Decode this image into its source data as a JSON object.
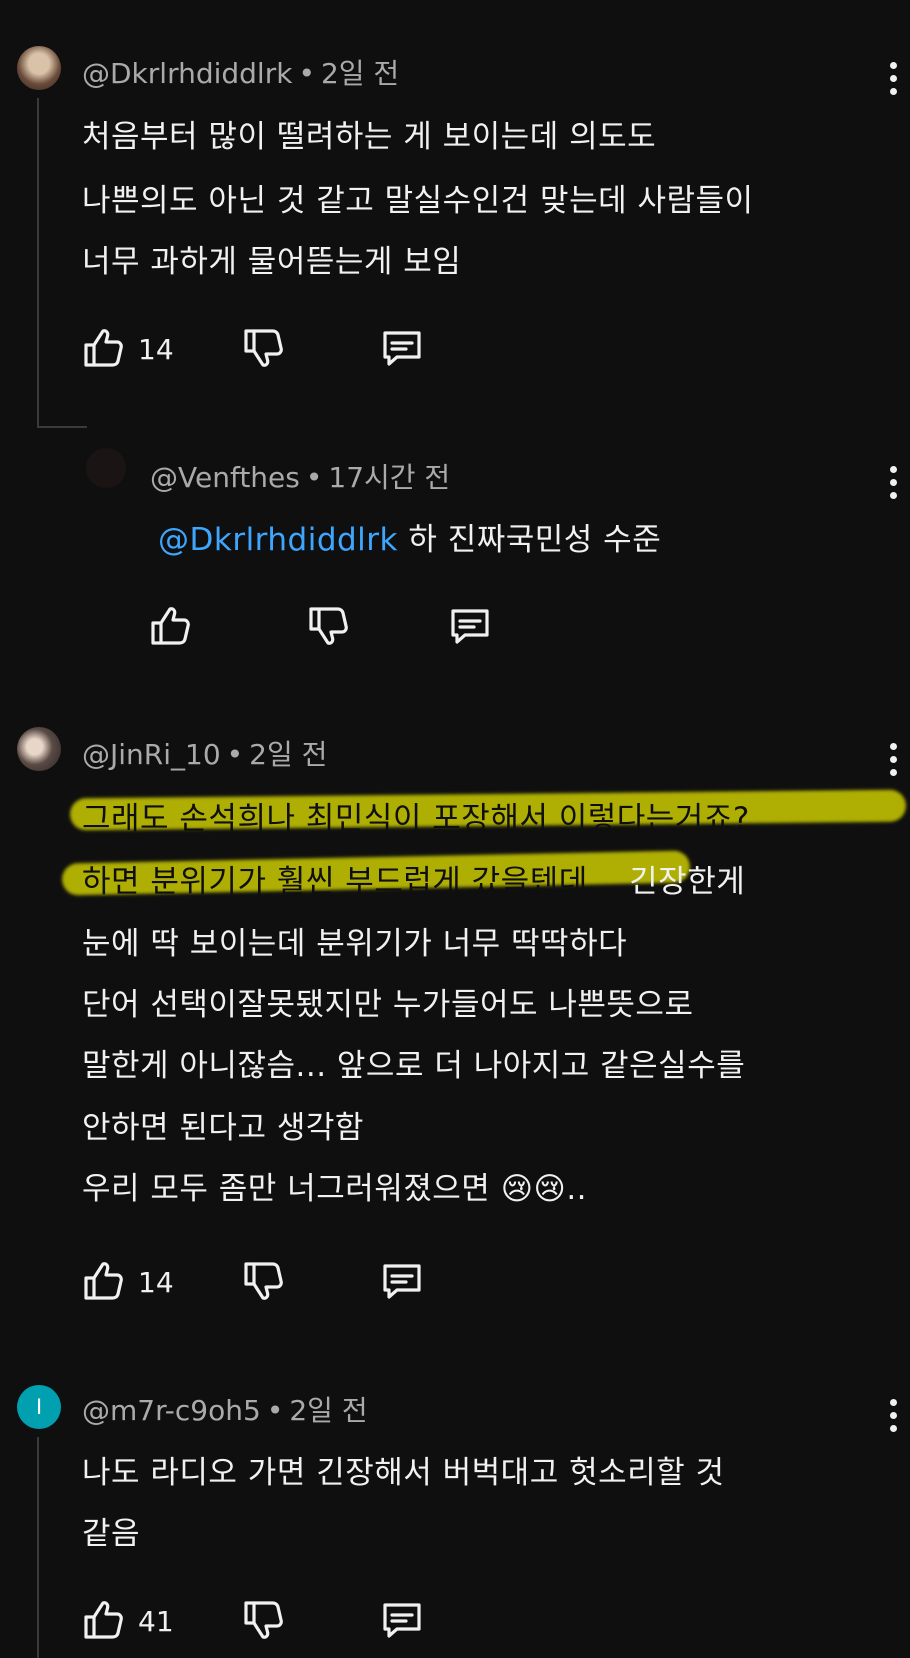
{
  "comments": [
    {
      "author": "@Dkrlrhdiddlrk",
      "time": "2일 전",
      "lines": [
        "처음부터 많이 떨려하는 게 보이는데 의도도",
        "나쁜의도 아닌 것 같고 말실수인건 맞는데 사람들이",
        "너무 과하게 물어뜯는게 보임"
      ],
      "likes": "14",
      "avatar_icon": "avatar-photo"
    },
    {
      "author": "@Venfthes",
      "time": "17시간 전",
      "mention": "@Dkrlrhdiddlrk",
      "text": "하 진짜국민성 수준",
      "avatar_icon": "avatar-dark"
    },
    {
      "author": "@JinRi_10",
      "time": "2일 전",
      "lines": [
        "그래도 손석희나 최민식이 포장해서 이렇다는거죠?",
        "하면 분위기가 훨씬 부드럽게 갔을텐데...",
        "긴장한게",
        "눈에 딱 보이는데 분위기가 너무 딱딱하다",
        "단어 선택이잘못됐지만 누가들어도 나쁜뜻으로",
        "말한게 아니잖슴... 앞으로 더 나아지고 같은실수를",
        "안하면 된다고 생각함",
        "우리 모두 좀만 너그러워졌으면",
        "😢😢..",
        ""
      ],
      "likes": "14",
      "highlight_color": "#d6d600",
      "avatar_icon": "avatar-photo"
    },
    {
      "author": "@m7r-c9oh5",
      "time": "2일 전",
      "avatar_letter": "I",
      "avatar_color": "#00a0b0",
      "lines": [
        "나도 라디오 가면 긴장해서 버벅대고 헛소리할 것",
        "같음"
      ],
      "likes": "41"
    }
  ],
  "icons": {
    "like": "thumb-up-icon",
    "dislike": "thumb-down-icon",
    "reply": "comment-icon",
    "more": "more-vert-icon"
  },
  "separator": "•"
}
